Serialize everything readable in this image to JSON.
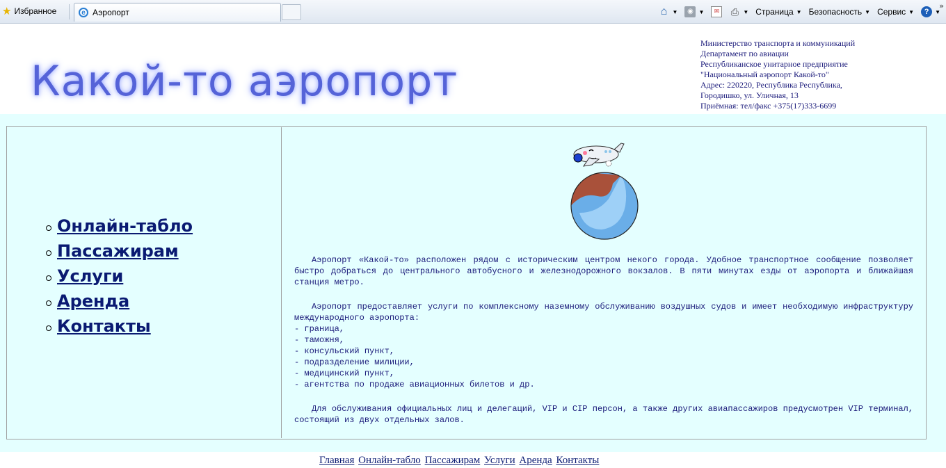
{
  "browser": {
    "favorites_label": "Избранное",
    "tab_title": "Аэропорт",
    "tools": {
      "page": "Страница",
      "safety": "Безопасность",
      "service": "Сервис"
    }
  },
  "header": {
    "site_title": "Какой-то аэропорт",
    "ministry_lines": [
      "Министерство транспорта и коммуникаций",
      "Департамент по авиации",
      "Республиканское унитарное предприятие",
      "\"Национальный аэропорт Какой-то\"",
      "Адрес: 220220, Республика Республика,",
      "Городишко, ул. Уличная, 13",
      "Приёмная: тел/факс +375(17)333-6699"
    ]
  },
  "nav": {
    "items": [
      "Онлайн-табло",
      "Пассажирам",
      "Услуги",
      "Аренда",
      "Контакты"
    ]
  },
  "content": {
    "paragraph1": "Аэропорт «Какой-то» расположен рядом с историческим центром некого города. Удобное транспортное сообщение позволяет быстро добраться до центрального автобусного и железнодорожного вокзалов. В пяти минутах езды от аэропорта и ближайшая станция метро.",
    "paragraph2_intro": "Аэропорт предоставляет услуги по комплексному наземному обслуживанию воздушных судов и имеет необходимую инфраструктуру международного аэропорта:",
    "services": [
      "- граница,",
      "- таможня,",
      "- консульский пункт,",
      "- подразделение милиции,",
      "- медицинский пункт,",
      "- агентства по продаже авиационных билетов и др."
    ],
    "paragraph3": "Для обслуживания официальных лиц и делегаций, VIP и CIP персон, а также других авиапассажиров предусмотрен VIP терминал, состоящий из двух отдельных залов."
  },
  "footer": {
    "links": [
      "Главная",
      "Онлайн-табло",
      "Пассажирам",
      "Услуги",
      "Аренда",
      "Контакты"
    ]
  },
  "colors": {
    "title": "#5563d8",
    "text": "#1a1a7a",
    "links": "#0a1a72",
    "background": "#e4ffff"
  }
}
